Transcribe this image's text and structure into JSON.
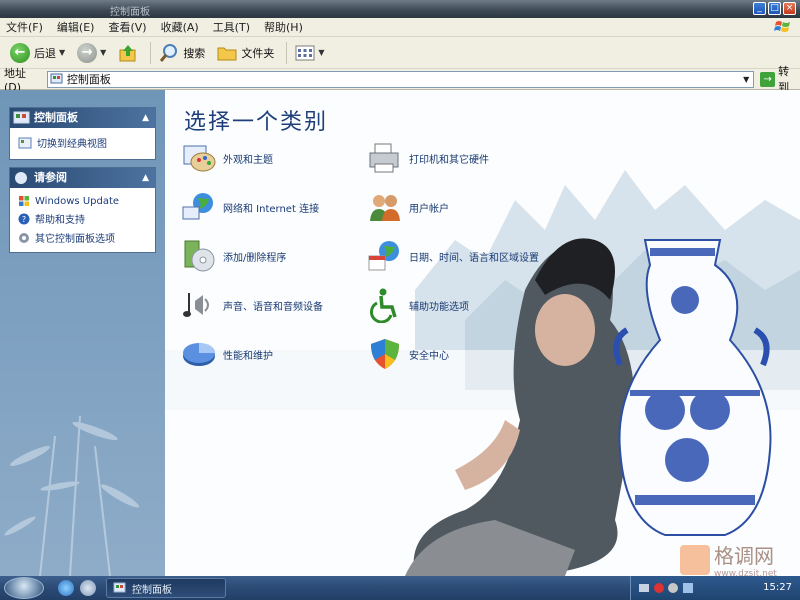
{
  "window": {
    "title": "控制面板"
  },
  "menubar": {
    "items": [
      "文件(F)",
      "编辑(E)",
      "查看(V)",
      "收藏(A)",
      "工具(T)",
      "帮助(H)"
    ]
  },
  "toolbar": {
    "back_label": "后退",
    "search_label": "搜索",
    "folders_label": "文件夹"
  },
  "address": {
    "label": "地址(D)",
    "value": "控制面板",
    "go_label": "转到"
  },
  "leftpane": {
    "panel1": {
      "title": "控制面板",
      "items": [
        {
          "label": "切换到经典视图"
        }
      ]
    },
    "panel2": {
      "title": "请参阅",
      "items": [
        {
          "label": "Windows Update"
        },
        {
          "label": "帮助和支持"
        },
        {
          "label": "其它控制面板选项"
        }
      ]
    }
  },
  "main": {
    "heading": "选择一个类别",
    "categories": [
      {
        "label": "外观和主题"
      },
      {
        "label": "打印机和其它硬件"
      },
      {
        "label": "网络和 Internet 连接"
      },
      {
        "label": "用户帐户"
      },
      {
        "label": "添加/删除程序"
      },
      {
        "label": "日期、时间、语言和区域设置"
      },
      {
        "label": "声音、语音和音频设备"
      },
      {
        "label": "辅助功能选项"
      },
      {
        "label": "性能和维护"
      },
      {
        "label": "安全中心"
      }
    ]
  },
  "taskbar": {
    "task_label": "控制面板",
    "clock": "15:27"
  },
  "watermark": {
    "name": "格调网",
    "url": "www.dzsit.net"
  }
}
